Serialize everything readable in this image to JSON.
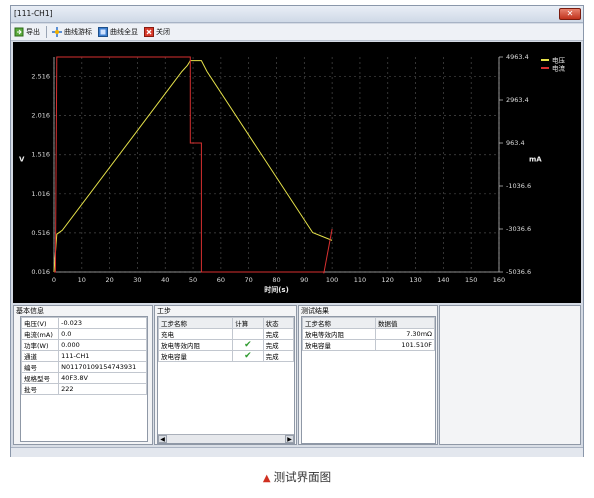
{
  "window": {
    "title": "[111-CH1]",
    "close_label": "✕"
  },
  "toolbar": {
    "export_label": "导出",
    "cursor_label": "曲线游标",
    "full_label": "曲线全显",
    "close_label": "关闭"
  },
  "chart_data": {
    "type": "line",
    "xlabel": "时间(s)",
    "ylabel_left": "V",
    "ylabel_right": "mA",
    "x_ticks": [
      "0",
      "10",
      "20",
      "30",
      "40",
      "50",
      "60",
      "70",
      "80",
      "90",
      "100",
      "110",
      "120",
      "130",
      "140",
      "150",
      "160"
    ],
    "y_left_ticks": [
      "2.516",
      "2.016",
      "1.516",
      "1.016",
      "0.516",
      "0.016"
    ],
    "y_right_ticks": [
      "4963.4",
      "2963.4",
      "963.4",
      "-1036.6",
      "-3036.6",
      "-5036.6"
    ],
    "xlim": [
      0,
      160
    ],
    "ylim_left": [
      0.016,
      2.766
    ],
    "ylim_right": [
      -5036.6,
      4963.4
    ],
    "grid": true,
    "legend_position": "top-right",
    "series": [
      {
        "name": "电压",
        "color": "#e6e24a",
        "axis": "left",
        "x": [
          0,
          1,
          3,
          46,
          48,
          49,
          53,
          55,
          93,
          100
        ],
        "y": [
          0.016,
          0.5,
          0.55,
          2.58,
          2.66,
          2.72,
          2.72,
          2.58,
          0.52,
          0.42
        ]
      },
      {
        "name": "电流",
        "color": "#d83030",
        "axis": "right",
        "x": [
          0,
          0.5,
          1,
          49,
          49,
          53,
          53,
          97,
          97,
          100
        ],
        "y": [
          -5036.6,
          -5036.6,
          4963.4,
          4963.4,
          963.4,
          963.4,
          -5036.6,
          -5036.6,
          -5100,
          -3036.6
        ]
      }
    ]
  },
  "basic_info": {
    "title": "基本信息",
    "rows": [
      {
        "label": "电压(V)",
        "value": "-0.023"
      },
      {
        "label": "电流(mA)",
        "value": "0.0"
      },
      {
        "label": "功率(W)",
        "value": "0.000"
      },
      {
        "label": "通道",
        "value": "111-CH1"
      },
      {
        "label": "编号",
        "value": "N01170109154743931"
      },
      {
        "label": "规格型号",
        "value": "40F3.8V"
      },
      {
        "label": "批号",
        "value": "222"
      }
    ]
  },
  "steps": {
    "title": "工步",
    "headers": [
      "工步名称",
      "计算",
      "状态"
    ],
    "rows": [
      {
        "name": "充电",
        "calc": "",
        "status": "完成"
      },
      {
        "name": "放电等效内阻",
        "calc": "✔",
        "status": "完成"
      },
      {
        "name": "放电容量",
        "calc": "✔",
        "status": "完成"
      }
    ],
    "scroll_left": "◀",
    "scroll_right": "▶"
  },
  "results": {
    "title": "测试结果",
    "headers": [
      "工步名称",
      "数据值"
    ],
    "rows": [
      {
        "name": "放电等效内阻",
        "value": "7.30mΩ"
      },
      {
        "name": "放电容量",
        "value": "101.510F"
      }
    ]
  },
  "caption": {
    "marker": "▲",
    "text": "测试界面图"
  }
}
